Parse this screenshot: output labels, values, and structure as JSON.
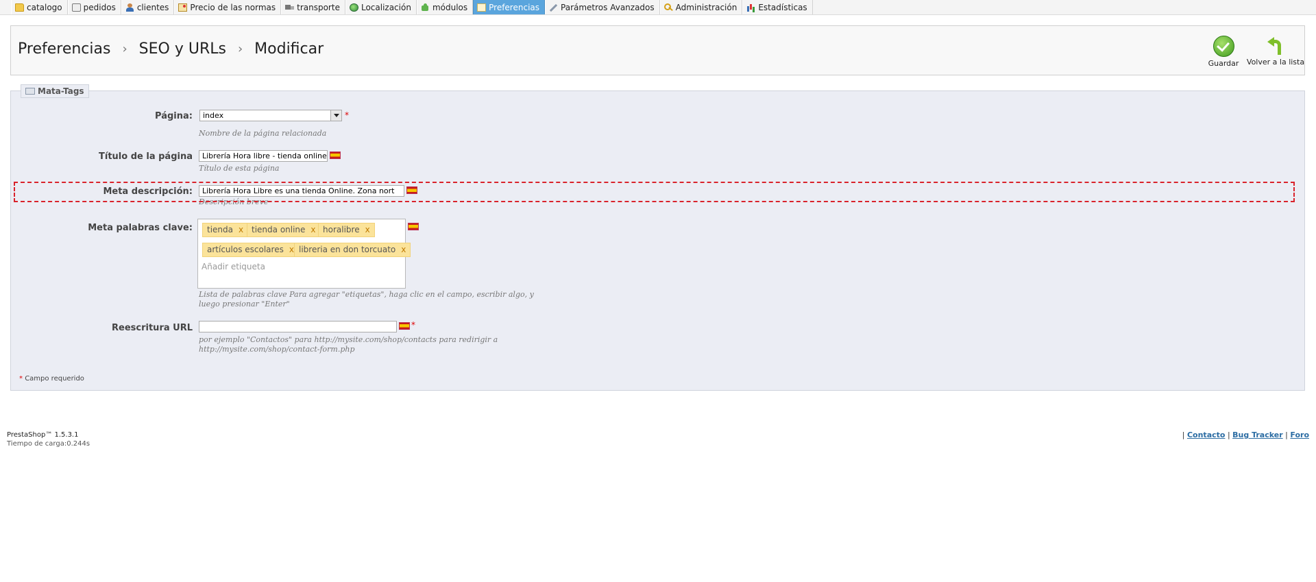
{
  "tabs": [
    {
      "label": "catalogo",
      "icon": "folder-icon",
      "active": false
    },
    {
      "label": "pedidos",
      "icon": "cart-icon",
      "active": false
    },
    {
      "label": "clientes",
      "icon": "user-icon",
      "active": false
    },
    {
      "label": "Precio de las normas",
      "icon": "price-tag-icon",
      "active": false
    },
    {
      "label": "transporte",
      "icon": "truck-icon",
      "active": false
    },
    {
      "label": "Localización",
      "icon": "globe-icon",
      "active": false
    },
    {
      "label": "módulos",
      "icon": "puzzle-icon",
      "active": false
    },
    {
      "label": "Preferencias",
      "icon": "preferences-icon",
      "active": true
    },
    {
      "label": "Parámetros Avanzados",
      "icon": "wrench-icon",
      "active": false
    },
    {
      "label": "Administración",
      "icon": "key-icon",
      "active": false
    },
    {
      "label": "Estadísticas",
      "icon": "stats-icon",
      "active": false
    }
  ],
  "breadcrumb": [
    "Preferencias",
    "SEO y URLs",
    "Modificar"
  ],
  "toolbar": {
    "save_label": "Guardar",
    "back_label": "Volver a la lista"
  },
  "fieldset": {
    "legend": "Mata-Tags",
    "page": {
      "label": "Página:",
      "value": "index",
      "hint": "Nombre de la página relacionada"
    },
    "title": {
      "label": "Título de la página",
      "value": "Librería Hora libre - tienda online",
      "hint": "Título de esta página"
    },
    "description": {
      "label": "Meta descripción:",
      "value": "Librería Hora Libre es una tienda Online. Zona nort",
      "hint": "Descripción breve"
    },
    "keywords": {
      "label": "Meta palabras clave:",
      "tags": [
        "tienda",
        "tienda online",
        "horalibre",
        "artículos escolares",
        "libreria en don torcuato"
      ],
      "remove_label": "x",
      "placeholder": "Añadir etiqueta",
      "hint_line1": "Lista de palabras clave Para agregar \"etiquetas\", haga clic en el campo, escribir algo, y",
      "hint_line2": "luego presionar \"Enter\""
    },
    "rewrite": {
      "label": "Reescritura URL",
      "value": "",
      "hint_line1": "por ejemplo \"Contactos\" para http://mysite.com/shop/contacts para redirigir a",
      "hint_line2": "http://mysite.com/shop/contact-form.php"
    },
    "required_mark": "*",
    "required_note": "Campo requerido"
  },
  "footer": {
    "version": "PrestaShop™ 1.5.3.1",
    "load_time": "Tiempo de carga:0.244s",
    "links": [
      "Contacto",
      "Bug Tracker",
      "Foro"
    ],
    "separator": "|"
  },
  "colors": {
    "active_tab": "#5aa5dd",
    "panel_bg": "#ebedf4",
    "tag_bg": "#fbe39a",
    "highlight": "#d9222a",
    "required": "#dd0000"
  }
}
